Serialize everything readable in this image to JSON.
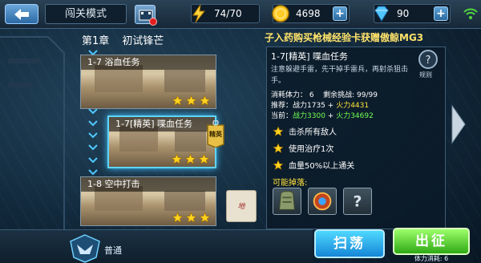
{
  "header": {
    "mode_title": "闯关模式",
    "stamina": "74/70",
    "gold": "4698",
    "diamonds": "90"
  },
  "chapter": {
    "number": "第1章",
    "name": "初试锋芒"
  },
  "marquee": "子入药购买枪械经验卡获赠傲鲸MG3",
  "missions": [
    {
      "label": "1-7 浴血任务",
      "stars": 3
    },
    {
      "label": "1-7[精英] 喋血任务",
      "stars": 3,
      "badge": "精英"
    },
    {
      "label": "1-8 空中打击",
      "stars": 3
    }
  ],
  "sign_text": "地",
  "difficulty_label": "普通",
  "detail": {
    "title": "1-7[精英]  喋血任务",
    "description": "注意躲避手雷，先干掉手雷兵，再射杀狙击手。",
    "rules_label": "规则",
    "cost_label": "消耗体力：",
    "cost_value": "6",
    "remaining_label": "剩余挑战:",
    "remaining_value": "99/99",
    "recommend_label": "推荐：战力1735 +",
    "recommend_bonus": "火力4431",
    "current_label": "当前：",
    "current_power": "战力3300",
    "current_plus": " + ",
    "current_bonus": "火力34692",
    "conditions": [
      "击杀所有敌人",
      "使用治疗1次",
      "血量50%以上通关"
    ],
    "drops_title": "可能掉落:"
  },
  "buttons": {
    "sweep": "扫荡",
    "go": "出征",
    "cost_note": "体力消耗: 6"
  },
  "colors": {
    "accent_blue": "#4fd8ff",
    "accent_green": "#2fa915",
    "highlight_yellow": "#ffe33c",
    "stat_green": "#72ff52"
  }
}
